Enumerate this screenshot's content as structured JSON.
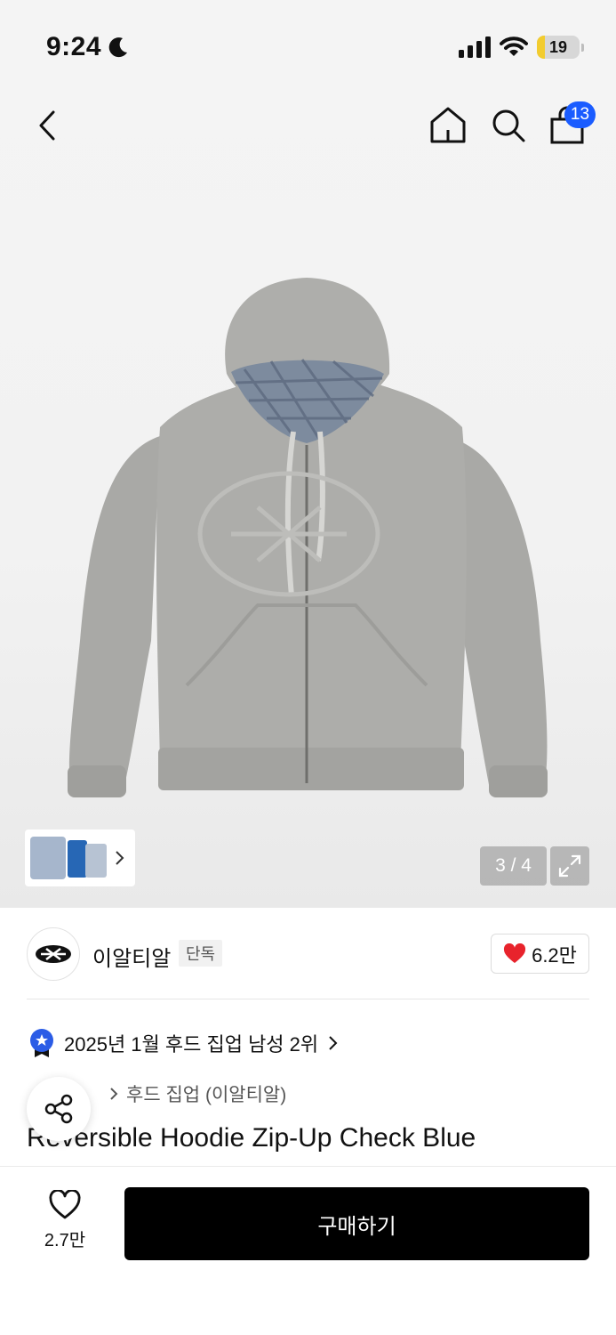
{
  "status_bar": {
    "time": "9:24",
    "battery_level": "19",
    "battery_fraction": 0.19
  },
  "nav": {
    "cart_count": "13"
  },
  "gallery": {
    "counter": "3 / 4"
  },
  "brand": {
    "name": "이알티알",
    "badge": "단독",
    "likes": "6.2만"
  },
  "ranking": {
    "text": "2025년 1월 후드 집업 남성 2위"
  },
  "breadcrumb": {
    "category": "후드 집업 (이알티알)"
  },
  "product": {
    "title": "Reversible Hoodie Zip-Up Check Blue"
  },
  "bottom": {
    "wish_count": "2.7만",
    "buy_label": "구매하기"
  },
  "colors": {
    "accent_blue": "#1a5cff",
    "heart_red": "#e8232c",
    "buy_bg": "#000000"
  },
  "icons": [
    "moon-icon",
    "signal-icon",
    "wifi-icon",
    "battery-icon",
    "back-icon",
    "home-icon",
    "search-icon",
    "shopping-bag-icon",
    "chevron-right-icon",
    "expand-icon",
    "heart-icon",
    "rank-medal-icon",
    "share-icon"
  ]
}
